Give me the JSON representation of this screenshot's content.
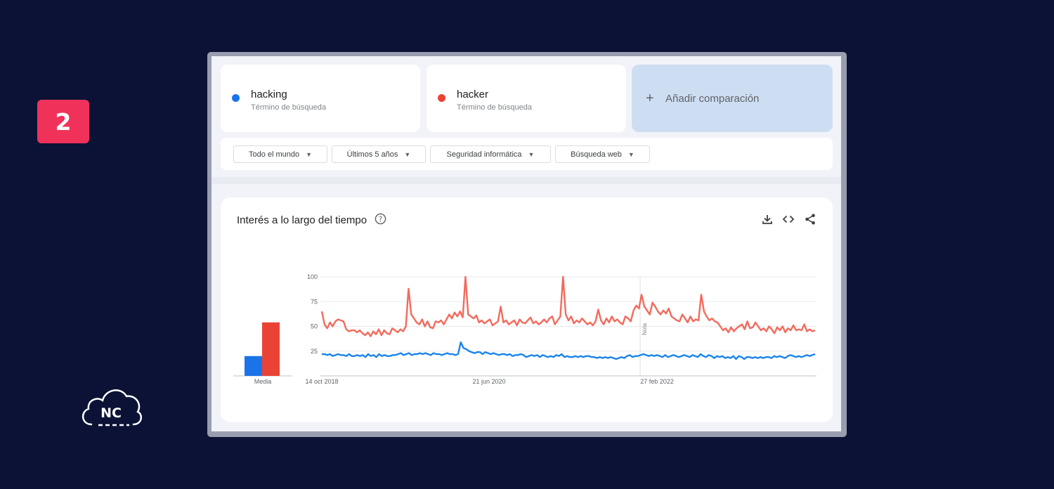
{
  "badge": {
    "number": "2"
  },
  "logo": {
    "text": "NC"
  },
  "search_terms": [
    {
      "name": "hacking",
      "subtitle": "Término de búsqueda",
      "color": "#1a73e8"
    },
    {
      "name": "hacker",
      "subtitle": "Término de búsqueda",
      "color": "#ea4335"
    }
  ],
  "add_comparison": {
    "icon": "plus-icon",
    "label": "Añadir comparación"
  },
  "filters": [
    {
      "label": "Todo el mundo"
    },
    {
      "label": "Últimos 5 años"
    },
    {
      "label": "Seguridad informática"
    },
    {
      "label": "Búsqueda web"
    }
  ],
  "chart_card": {
    "title": "Interés a lo largo del tiempo",
    "help_icon": "help-circle-icon",
    "tools": [
      "download-icon",
      "embed-code-icon",
      "share-icon"
    ]
  },
  "chart_data": [
    {
      "type": "bar",
      "categories": [
        "Media"
      ],
      "series": [
        {
          "name": "hacking",
          "values": [
            20
          ],
          "color": "#1a73e8"
        },
        {
          "name": "hacker",
          "values": [
            54
          ],
          "color": "#ea4335"
        }
      ],
      "xlabel": "Media",
      "ylim": [
        0,
        100
      ]
    },
    {
      "type": "line",
      "x_tick_labels": [
        "14 oct 2018",
        "21 jun 2020",
        "27 feb 2022"
      ],
      "y_ticks": [
        25,
        50,
        75,
        100
      ],
      "ylim": [
        0,
        100
      ],
      "annotation": "Nota",
      "grid": true,
      "series": [
        {
          "name": "hacker",
          "color": "#f36a5c",
          "values": [
            65,
            52,
            48,
            54,
            50,
            55,
            57,
            56,
            55,
            47,
            45,
            46,
            46,
            44,
            46,
            43,
            41,
            44,
            40,
            45,
            42,
            47,
            41,
            46,
            43,
            42,
            48,
            46,
            44,
            47,
            45,
            50,
            88,
            62,
            58,
            54,
            52,
            57,
            50,
            55,
            49,
            48,
            55,
            54,
            56,
            52,
            57,
            62,
            58,
            64,
            60,
            65,
            59,
            100,
            62,
            60,
            58,
            61,
            54,
            56,
            53,
            55,
            57,
            51,
            53,
            55,
            70,
            54,
            56,
            52,
            54,
            56,
            51,
            57,
            54,
            53,
            56,
            59,
            53,
            55,
            52,
            54,
            57,
            54,
            58,
            60,
            52,
            56,
            60,
            100,
            62,
            56,
            60,
            53,
            56,
            54,
            58,
            55,
            52,
            54,
            51,
            55,
            67,
            56,
            52,
            58,
            54,
            60,
            55,
            57,
            54,
            52,
            60,
            58,
            55,
            66,
            71,
            68,
            82,
            70,
            66,
            62,
            74,
            70,
            65,
            62,
            66,
            63,
            68,
            60,
            58,
            56,
            55,
            62,
            58,
            54,
            60,
            55,
            57,
            56,
            82,
            65,
            60,
            56,
            58,
            55,
            54,
            50,
            46,
            48,
            44,
            49,
            45,
            48,
            50,
            52,
            47,
            55,
            48,
            49,
            54,
            50,
            46,
            48,
            45,
            50,
            47,
            43,
            49,
            46,
            50,
            44,
            48,
            46,
            51,
            46,
            47,
            46,
            52,
            45,
            47,
            45,
            46
          ]
        },
        {
          "name": "hacking",
          "color": "#1a84ee",
          "values": [
            22,
            22,
            21,
            22,
            20,
            21,
            22,
            21,
            21,
            20,
            22,
            20,
            20,
            21,
            20,
            21,
            19,
            22,
            20,
            21,
            19,
            22,
            20,
            21,
            20,
            20,
            21,
            21,
            22,
            23,
            21,
            22,
            23,
            21,
            22,
            22,
            23,
            22,
            23,
            22,
            21,
            23,
            22,
            22,
            21,
            22,
            23,
            22,
            22,
            21,
            22,
            34,
            28,
            27,
            25,
            24,
            23,
            24,
            24,
            22,
            24,
            23,
            22,
            23,
            22,
            21,
            22,
            22,
            21,
            22,
            20,
            21,
            21,
            22,
            21,
            19,
            20,
            21,
            20,
            21,
            19,
            21,
            20,
            19,
            20,
            19,
            21,
            20,
            22,
            19,
            20,
            19,
            19,
            20,
            19,
            20,
            19,
            20,
            20,
            19,
            19,
            18,
            19,
            18,
            19,
            18,
            19,
            18,
            17,
            18,
            19,
            18,
            20,
            21,
            19,
            20,
            20,
            21,
            22,
            21,
            20,
            21,
            20,
            21,
            20,
            19,
            21,
            19,
            20,
            21,
            20,
            19,
            20,
            21,
            20,
            19,
            21,
            20,
            19,
            22,
            20,
            19,
            21,
            20,
            18,
            20,
            19,
            20,
            18,
            19,
            18,
            20,
            17,
            20,
            19,
            17,
            19,
            19,
            18,
            19,
            18,
            19,
            18,
            19,
            19,
            18,
            20,
            19,
            20,
            19,
            18,
            20,
            21,
            20,
            19,
            20,
            19,
            20,
            21,
            20,
            21,
            22
          ]
        }
      ]
    }
  ]
}
